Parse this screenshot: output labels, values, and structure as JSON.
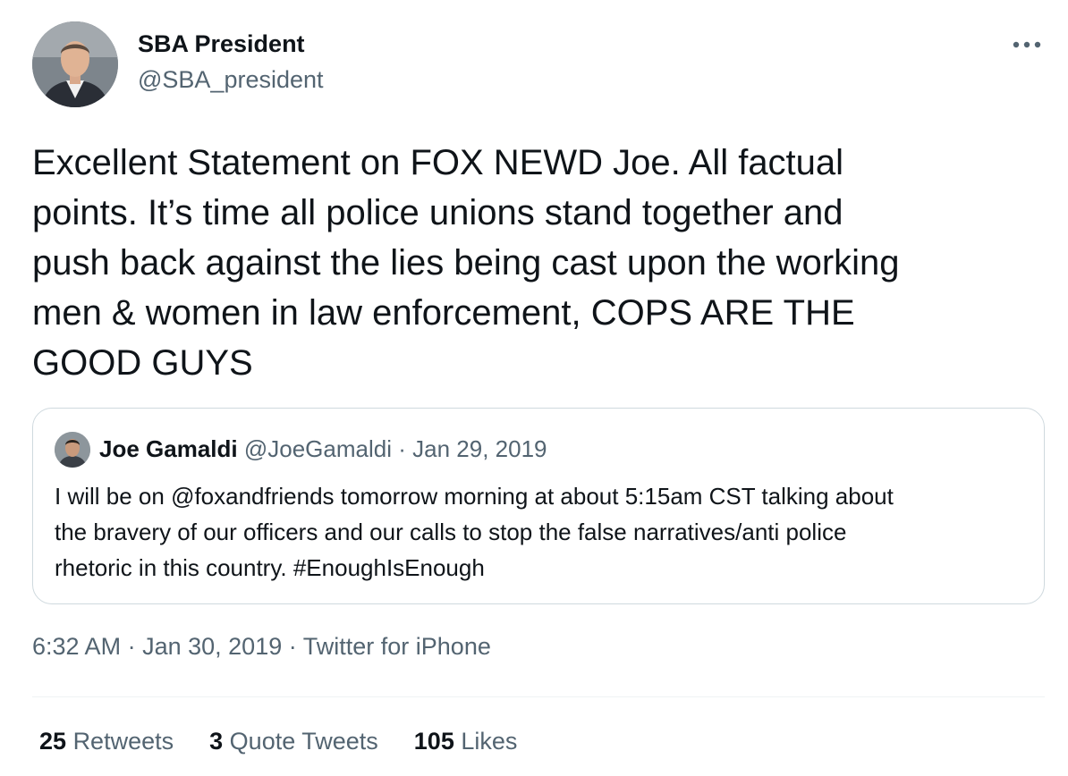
{
  "author": {
    "display_name": "SBA President",
    "handle": "@SBA_president"
  },
  "more_icon": "more-horizontal-icon",
  "tweet": {
    "text": "Excellent Statement on FOX NEWD Joe. All factual\npoints. It’s time all police unions stand together and\npush back against the lies being cast upon the working\nmen & women in law enforcement, COPS ARE THE\nGOOD GUYS"
  },
  "quoted_tweet": {
    "display_name": "Joe Gamaldi",
    "handle": "@JoeGamaldi",
    "separator": "·",
    "date": "Jan 29, 2019",
    "text": "I will be on @foxandfriends tomorrow morning at about 5:15am CST talking about\nthe bravery of our officers and our calls to stop the false narratives/anti police\nrhetoric in this country. #EnoughIsEnough"
  },
  "meta": {
    "time": "6:32 AM",
    "separator": "·",
    "date": "Jan 30, 2019",
    "source": "Twitter for iPhone"
  },
  "stats": [
    {
      "count": "25",
      "label": "Retweets"
    },
    {
      "count": "3",
      "label": "Quote Tweets"
    },
    {
      "count": "105",
      "label": "Likes"
    }
  ],
  "colors": {
    "text_primary": "#0f1419",
    "text_secondary": "#536471",
    "border": "#cfd9de",
    "divider": "#eff3f4"
  }
}
